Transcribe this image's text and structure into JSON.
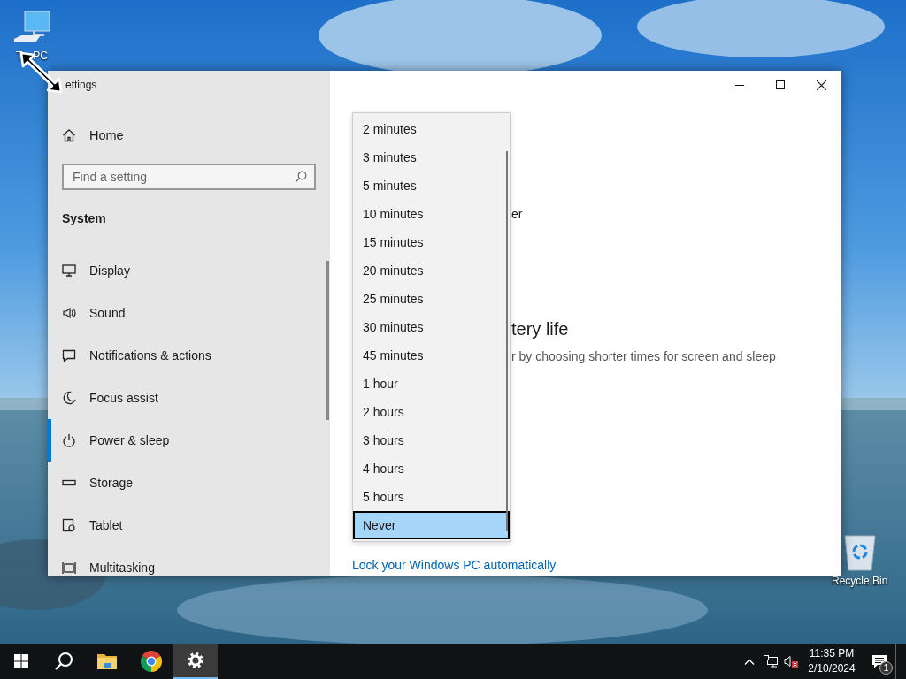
{
  "desktop": {
    "icons": [
      {
        "label_pieces": [
          "T",
          "PC"
        ]
      },
      {
        "label_pieces": [
          "Recycle Bin"
        ]
      }
    ]
  },
  "window": {
    "title": "ettings"
  },
  "sidebar": {
    "home": "Home",
    "search": {
      "placeholder": "Find a setting"
    },
    "section": "System",
    "items": [
      {
        "label": "Display",
        "selected": false
      },
      {
        "label": "Sound",
        "selected": false
      },
      {
        "label": "Notifications & actions",
        "selected": false
      },
      {
        "label": "Focus assist",
        "selected": false
      },
      {
        "label": "Power & sleep",
        "selected": true
      },
      {
        "label": "Storage",
        "selected": false
      },
      {
        "label": "Tablet",
        "selected": false
      },
      {
        "label": "Multitasking",
        "selected": false
      }
    ]
  },
  "content": {
    "fragment_1": "er",
    "heading_fragment": "tery life",
    "description_fragment": "r by choosing shorter times for screen and sleep",
    "link": "Lock your Windows PC automatically"
  },
  "dropdown": {
    "options": [
      {
        "label": "2 minutes",
        "selected": false
      },
      {
        "label": "3 minutes",
        "selected": false
      },
      {
        "label": "5 minutes",
        "selected": false
      },
      {
        "label": "10 minutes",
        "selected": false
      },
      {
        "label": "15 minutes",
        "selected": false
      },
      {
        "label": "20 minutes",
        "selected": false
      },
      {
        "label": "25 minutes",
        "selected": false
      },
      {
        "label": "30 minutes",
        "selected": false
      },
      {
        "label": "45 minutes",
        "selected": false
      },
      {
        "label": "1 hour",
        "selected": false
      },
      {
        "label": "2 hours",
        "selected": false
      },
      {
        "label": "3 hours",
        "selected": false
      },
      {
        "label": "4 hours",
        "selected": false
      },
      {
        "label": "5 hours",
        "selected": false
      },
      {
        "label": "Never",
        "selected": true
      }
    ]
  },
  "taskbar": {
    "apps": [
      {
        "kind": "start",
        "active": false
      },
      {
        "kind": "search",
        "active": false
      },
      {
        "kind": "explorer",
        "active": false
      },
      {
        "kind": "chrome",
        "active": false
      },
      {
        "kind": "settings",
        "active": true
      }
    ],
    "time": "11:35 PM",
    "date": "2/10/2024",
    "notification_count": "1"
  }
}
